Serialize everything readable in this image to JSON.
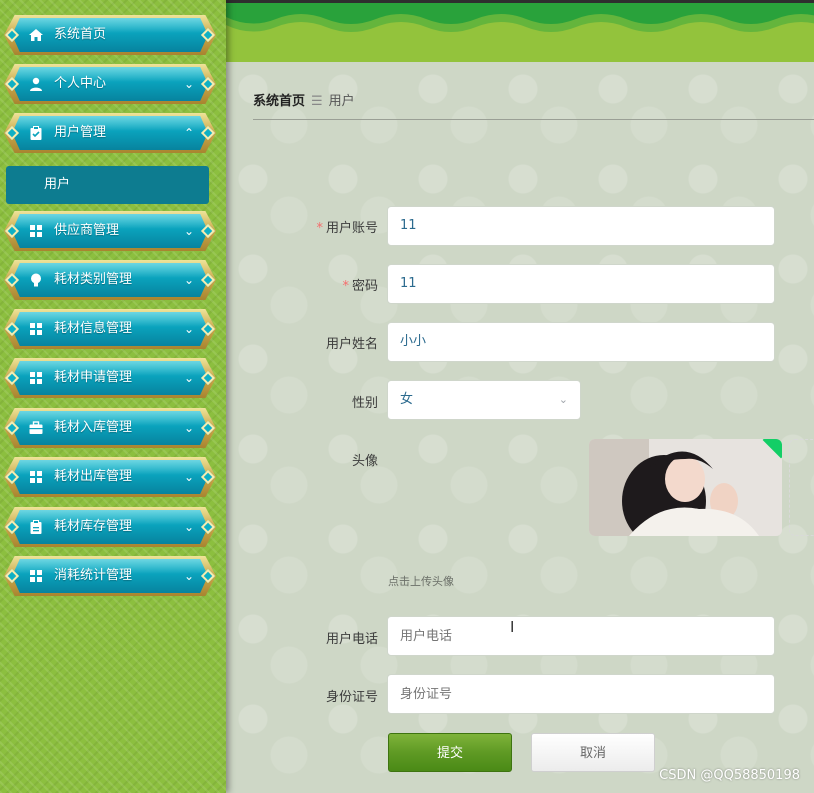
{
  "sidebar": {
    "items": [
      {
        "label": "系统首页",
        "icon": "home-icon"
      },
      {
        "label": "个人中心",
        "icon": "user-icon"
      },
      {
        "label": "用户管理",
        "icon": "clipboard-icon",
        "expanded": true
      },
      {
        "label": "供应商管理",
        "icon": "grid-icon"
      },
      {
        "label": "耗材类别管理",
        "icon": "bulb-icon"
      },
      {
        "label": "耗材信息管理",
        "icon": "grid-icon"
      },
      {
        "label": "耗材申请管理",
        "icon": "grid-icon"
      },
      {
        "label": "耗材入库管理",
        "icon": "briefcase-icon"
      },
      {
        "label": "耗材出库管理",
        "icon": "grid-icon"
      },
      {
        "label": "耗材库存管理",
        "icon": "clipboard-icon"
      },
      {
        "label": "消耗统计管理",
        "icon": "grid-icon"
      }
    ],
    "submenu": {
      "label": "用户"
    }
  },
  "breadcrumb": {
    "home": "系统首页",
    "separator": "☰",
    "current": "用户"
  },
  "form": {
    "account": {
      "label": "用户账号",
      "value": "11",
      "required": true
    },
    "password": {
      "label": "密码",
      "value": "11",
      "required": true
    },
    "name": {
      "label": "用户姓名",
      "value": "小小"
    },
    "gender": {
      "label": "性别",
      "value": "女"
    },
    "avatar": {
      "label": "头像",
      "tip": "点击上传头像"
    },
    "phone": {
      "label": "用户电话",
      "placeholder": "用户电话"
    },
    "idcard": {
      "label": "身份证号",
      "placeholder": "身份证号"
    },
    "submit": "提交",
    "cancel": "取消"
  },
  "watermark": "CSDN @QQ58850198",
  "colors": {
    "menu_teal": "#0aa2bc",
    "menu_gold": "#caa74c",
    "header_green": "#93c33c",
    "submit_green": "#5f9a24",
    "required": "#f56c6c"
  }
}
